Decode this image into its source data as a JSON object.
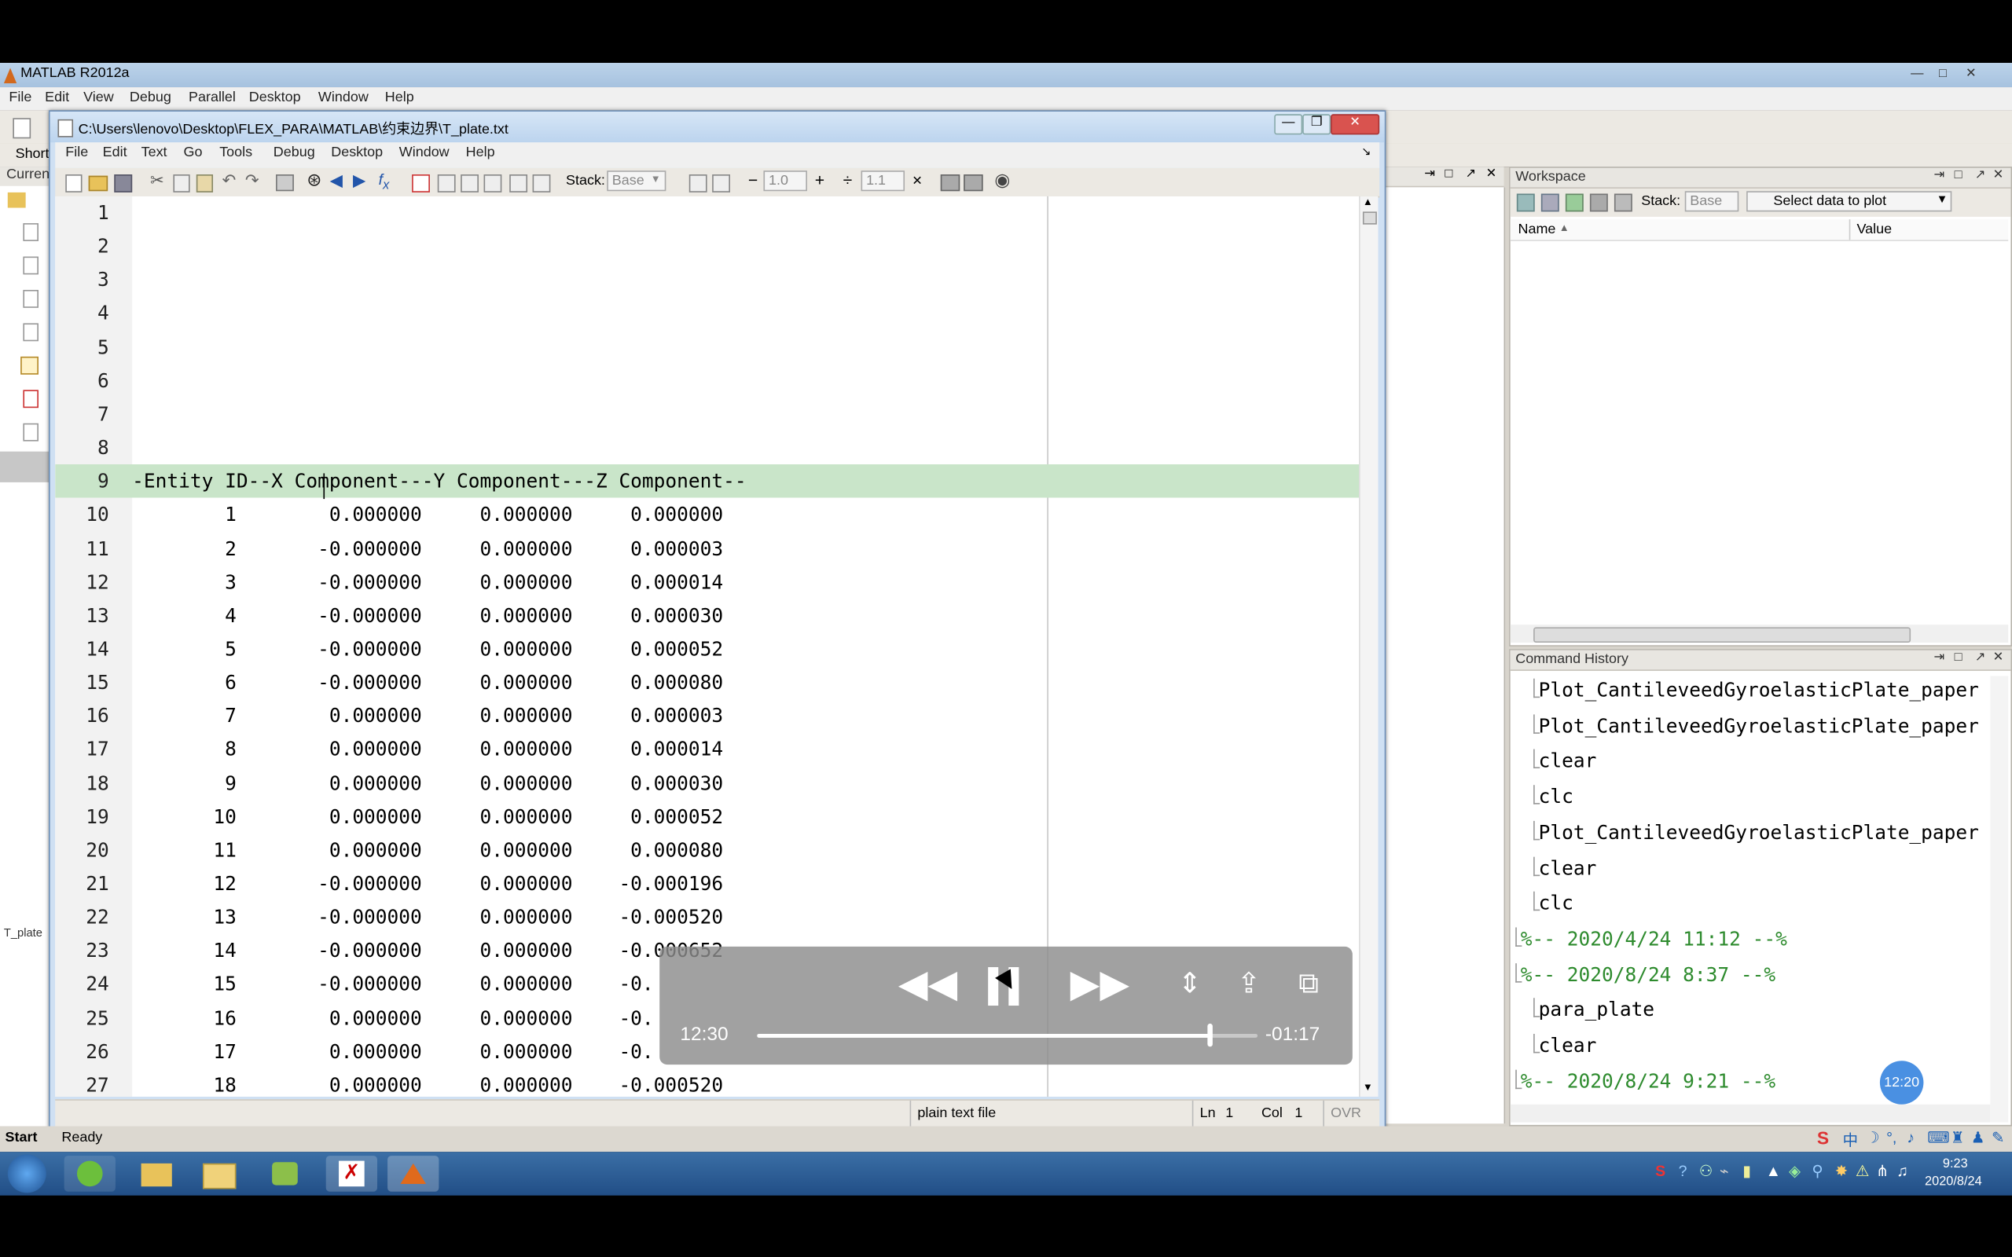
{
  "app": {
    "main_title": "MATLAB  R2012a",
    "main_menu": [
      "File",
      "Edit",
      "View",
      "Debug",
      "Parallel",
      "Desktop",
      "Window",
      "Help"
    ],
    "shortcuts_label": "Short",
    "current_folder_label": "Curren",
    "current_file_tab": "T_plate",
    "status_ready": "Ready",
    "start_label": "Start"
  },
  "editor": {
    "title": "C:\\Users\\lenovo\\Desktop\\FLEX_PARA\\MATLAB\\约束边界\\T_plate.txt",
    "menu": [
      "File",
      "Edit",
      "Text",
      "Go",
      "Tools",
      "Debug",
      "Desktop",
      "Window",
      "Help"
    ],
    "toolbar": {
      "stack_label": "Stack:",
      "stack_value": "Base",
      "minus": "−",
      "value1": "1.0",
      "plus": "+",
      "divide": "÷",
      "value2": "1.1",
      "times": "×"
    },
    "status": {
      "file_type": "plain text file",
      "ln_label": "Ln",
      "ln_value": "1",
      "col_label": "Col",
      "col_value": "1",
      "ovr": "OVR"
    },
    "lines": [
      {
        "n": "1",
        "text": ""
      },
      {
        "n": "2",
        "text": ""
      },
      {
        "n": "3",
        "text": ""
      },
      {
        "n": "4",
        "text": ""
      },
      {
        "n": "5",
        "text": ""
      },
      {
        "n": "6",
        "text": ""
      },
      {
        "n": "7",
        "text": ""
      },
      {
        "n": "8",
        "text": ""
      },
      {
        "n": "9",
        "text": "-Entity ID--X Component---Y Component---Z Component--"
      },
      {
        "n": "10",
        "text": "        1        0.000000     0.000000     0.000000"
      },
      {
        "n": "11",
        "text": "        2       -0.000000     0.000000     0.000003"
      },
      {
        "n": "12",
        "text": "        3       -0.000000     0.000000     0.000014"
      },
      {
        "n": "13",
        "text": "        4       -0.000000     0.000000     0.000030"
      },
      {
        "n": "14",
        "text": "        5       -0.000000     0.000000     0.000052"
      },
      {
        "n": "15",
        "text": "        6       -0.000000     0.000000     0.000080"
      },
      {
        "n": "16",
        "text": "        7        0.000000     0.000000     0.000003"
      },
      {
        "n": "17",
        "text": "        8        0.000000     0.000000     0.000014"
      },
      {
        "n": "18",
        "text": "        9        0.000000     0.000000     0.000030"
      },
      {
        "n": "19",
        "text": "       10        0.000000     0.000000     0.000052"
      },
      {
        "n": "20",
        "text": "       11        0.000000     0.000000     0.000080"
      },
      {
        "n": "21",
        "text": "       12       -0.000000     0.000000    -0.000196"
      },
      {
        "n": "22",
        "text": "       13       -0.000000     0.000000    -0.000520"
      },
      {
        "n": "23",
        "text": "       14       -0.000000     0.000000    -0.000652"
      },
      {
        "n": "24",
        "text": "       15       -0.000000     0.000000    -0."
      },
      {
        "n": "25",
        "text": "       16        0.000000     0.000000    -0."
      },
      {
        "n": "26",
        "text": "       17        0.000000     0.000000    -0."
      },
      {
        "n": "27",
        "text": "       18        0.000000     0.000000    -0.000520"
      }
    ],
    "highlight_line": 9
  },
  "workspace": {
    "title": "Workspace",
    "stack_label": "Stack:",
    "stack_value": "Base",
    "plot_select": "Select data to plot",
    "col_name": "Name",
    "col_value": "Value"
  },
  "command_history": {
    "title": "Command History",
    "entries": [
      {
        "text": "Plot_CantileveedGyroelasticPlate_paper",
        "type": "cmd"
      },
      {
        "text": "Plot_CantileveedGyroelasticPlate_paper",
        "type": "cmd"
      },
      {
        "text": "clear",
        "type": "cmd"
      },
      {
        "text": "clc",
        "type": "cmd"
      },
      {
        "text": "Plot_CantileveedGyroelasticPlate_paper",
        "type": "cmd"
      },
      {
        "text": "clear",
        "type": "cmd"
      },
      {
        "text": "clc",
        "type": "cmd"
      },
      {
        "text": "%-- 2020/4/24 11:12 --%",
        "type": "session"
      },
      {
        "text": "%-- 2020/8/24 8:37 --%",
        "type": "session"
      },
      {
        "text": "para_plate",
        "type": "cmd"
      },
      {
        "text": "clear",
        "type": "cmd"
      },
      {
        "text": "%-- 2020/8/24 9:21 --%",
        "type": "session"
      }
    ],
    "badge": "12:20"
  },
  "video": {
    "elapsed": "12:30",
    "remaining": "-01:17",
    "progress": 0.905
  },
  "taskbar": {
    "clock_time": "9:23",
    "clock_date": "2020/8/24"
  },
  "colors": {
    "highlight_green": "#c9e5c9",
    "history_session_green": "#2e8b2e",
    "taskbar_blue": "#2a5a93"
  }
}
